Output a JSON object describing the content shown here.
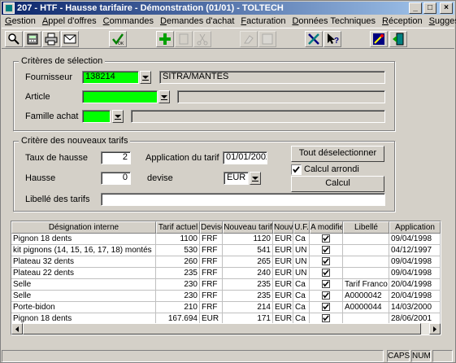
{
  "window": {
    "title": "207 - HTF - Hausse tarifaire - Démonstration (01/01) - TOLTECH",
    "min_label": "_",
    "max_label": "□",
    "close_label": "×"
  },
  "menu": [
    "Gestion",
    "Appel d'offres",
    "Commandes",
    "Demandes d'achat",
    "Facturation",
    "Données Techniques",
    "Réception",
    "Suggestions"
  ],
  "toolbar": {
    "icons": [
      "search-icon",
      "calculator-icon",
      "printer-icon",
      "envelope-icon",
      "validate-ok-icon",
      "add-icon",
      "copy-icon",
      "cut-icon",
      "erase-icon",
      "clear-icon",
      "tools-icon",
      "help-icon",
      "wizard-icon",
      "exit-icon"
    ],
    "ok_label": "OK"
  },
  "selection": {
    "group_label": "Critères de sélection",
    "fournisseur_label": "Fournisseur",
    "fournisseur_value": "138214",
    "fournisseur_name": "SITRA/MANTES",
    "article_label": "Article",
    "article_value": "",
    "article_desc": "",
    "famille_label": "Famille achat",
    "famille_value": "",
    "famille_desc": ""
  },
  "tarifs": {
    "group_label": "Critère des nouveaux tarifs",
    "taux_label": "Taux de hausse",
    "taux_value": "2",
    "application_label": "Application du tarif",
    "application_value": "01/01/2002",
    "hausse_label": "Hausse",
    "hausse_value": "0",
    "devise_label": "devise",
    "devise_value": "EUR",
    "libelle_label": "Libellé des tarifs",
    "libelle_value": "",
    "deselect_button": "Tout déselectionner",
    "calcul_arrondi_label": "Calcul arrondi",
    "calcul_arrondi_checked": true,
    "calcul_button": "Calcul"
  },
  "grid": {
    "columns": [
      "Désignation interne",
      "Tarif actuel",
      "Devise",
      "Nouveau tarif",
      "Nouveau",
      "U.F.",
      "A modifier",
      "Libellé",
      "Application"
    ],
    "rows": [
      [
        "Pignon 18 dents",
        "1100",
        "FRF",
        "1120",
        "EUR",
        "Ca",
        true,
        "",
        "09/04/1998"
      ],
      [
        "kit pignons (14, 15, 16, 17, 18) montés",
        "530",
        "FRF",
        "541",
        "EUR",
        "UN",
        true,
        "",
        "04/12/1997"
      ],
      [
        "Plateau 32 dents",
        "260",
        "FRF",
        "265",
        "EUR",
        "UN",
        true,
        "",
        "09/04/1998"
      ],
      [
        "Plateau 22 dents",
        "235",
        "FRF",
        "240",
        "EUR",
        "UN",
        true,
        "",
        "09/04/1998"
      ],
      [
        "Selle",
        "230",
        "FRF",
        "235",
        "EUR",
        "Ca",
        true,
        "Tarif Franco",
        "20/04/1998"
      ],
      [
        "Selle",
        "230",
        "FRF",
        "235",
        "EUR",
        "Ca",
        true,
        "A0000042",
        "20/04/1998"
      ],
      [
        "Porte-bidon",
        "210",
        "FRF",
        "214",
        "EUR",
        "Ca",
        true,
        "A0000044",
        "14/03/2000"
      ],
      [
        "Pignon 18 dents",
        "167.694",
        "EUR",
        "171",
        "EUR",
        "Ca",
        true,
        "",
        "28/06/2001"
      ]
    ]
  },
  "status": {
    "caps": "CAPS",
    "num": "NUM"
  }
}
